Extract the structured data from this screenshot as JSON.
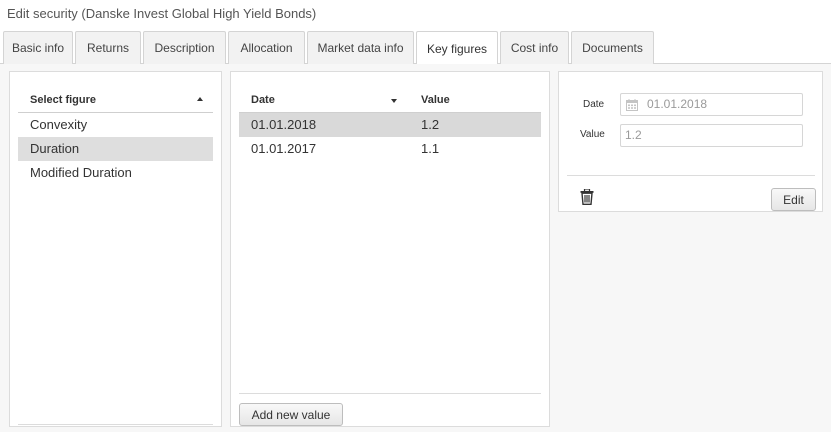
{
  "window": {
    "title": "Edit security (Danske Invest Global High Yield Bonds)"
  },
  "tabs": [
    {
      "label": "Basic info",
      "active": false
    },
    {
      "label": "Returns",
      "active": false
    },
    {
      "label": "Description",
      "active": false
    },
    {
      "label": "Allocation",
      "active": false
    },
    {
      "label": "Market data info",
      "active": false
    },
    {
      "label": "Key figures",
      "active": true
    },
    {
      "label": "Cost info",
      "active": false
    },
    {
      "label": "Documents",
      "active": false
    }
  ],
  "figures": {
    "header": "Select figure",
    "sort_icon": "sort-ascending-icon",
    "items": [
      {
        "label": "Convexity",
        "selected": false
      },
      {
        "label": "Duration",
        "selected": true
      },
      {
        "label": "Modified Duration",
        "selected": false
      }
    ]
  },
  "values": {
    "columns": {
      "date": "Date",
      "value": "Value"
    },
    "sort_icon": "sort-descending-icon",
    "rows": [
      {
        "date": "01.01.2018",
        "value": "1.2",
        "selected": true
      },
      {
        "date": "01.01.2017",
        "value": "1.1",
        "selected": false
      }
    ],
    "add_button": "Add new value"
  },
  "detail": {
    "date_label": "Date",
    "date_value": "01.01.2018",
    "value_label": "Value",
    "value_value": "1.2",
    "date_icon": "calendar-icon",
    "delete_icon": "trash-icon",
    "edit_button": "Edit"
  },
  "colors": {
    "selected_row": "#d9d9d9",
    "panel_border": "#dcdcdc",
    "background": "#f7f7f7"
  }
}
